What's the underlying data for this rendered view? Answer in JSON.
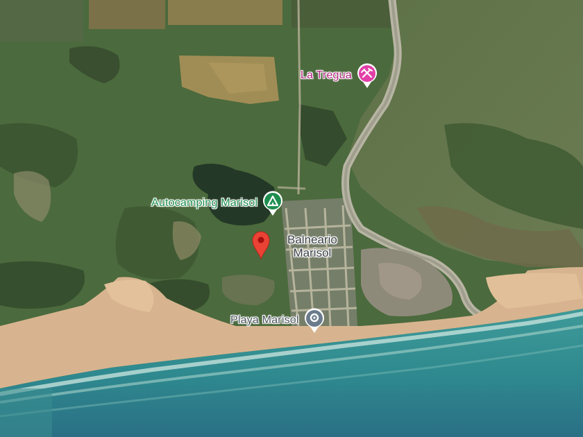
{
  "map": {
    "view": "satellite",
    "pois": {
      "la_tregua": {
        "label": "La Tregua",
        "icon": "hiking-axe-icon",
        "color": "#e23fa7",
        "text_color": "#b3247f"
      },
      "autocamping": {
        "label": "Autocamping Marisol",
        "icon": "campground-icon",
        "color": "#1e8e4f",
        "text_color": "#1e8e4f"
      },
      "playa": {
        "label": "Playa Marisol",
        "icon": "beach-location-icon",
        "color": "#6b7b8c",
        "text_color": "#4d5660"
      }
    },
    "selected_place": {
      "name_line1": "Balneario",
      "name_line2": "Marisol",
      "marker_icon": "red-location-pin-icon",
      "color": "#ea4335"
    }
  }
}
